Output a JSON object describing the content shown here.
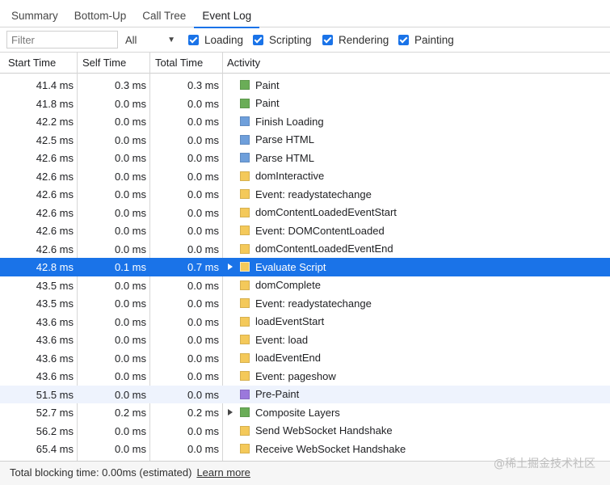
{
  "tabs": [
    {
      "label": "Summary",
      "active": false
    },
    {
      "label": "Bottom-Up",
      "active": false
    },
    {
      "label": "Call Tree",
      "active": false
    },
    {
      "label": "Event Log",
      "active": true
    }
  ],
  "filterbar": {
    "filter_placeholder": "Filter",
    "select_value": "All",
    "checkboxes": [
      {
        "label": "Loading",
        "checked": true
      },
      {
        "label": "Scripting",
        "checked": true
      },
      {
        "label": "Rendering",
        "checked": true
      },
      {
        "label": "Painting",
        "checked": true
      }
    ]
  },
  "columns": [
    "Start Time",
    "Self Time",
    "Total Time",
    "Activity"
  ],
  "colors": {
    "painting": "#6aad57",
    "loading": "#6e9fdb",
    "scripting": "#f4c95a",
    "rendering": "#9b78dc",
    "selection": "#1a73e8"
  },
  "rows": [
    {
      "start": "41.4 ms",
      "self": "0.3 ms",
      "total": "0.3 ms",
      "activity": "Paint",
      "category": "painting",
      "expandable": false
    },
    {
      "start": "41.8 ms",
      "self": "0.0 ms",
      "total": "0.0 ms",
      "activity": "Paint",
      "category": "painting",
      "expandable": false
    },
    {
      "start": "42.2 ms",
      "self": "0.0 ms",
      "total": "0.0 ms",
      "activity": "Finish Loading",
      "category": "loading",
      "expandable": false
    },
    {
      "start": "42.5 ms",
      "self": "0.0 ms",
      "total": "0.0 ms",
      "activity": "Parse HTML",
      "category": "loading",
      "expandable": false
    },
    {
      "start": "42.6 ms",
      "self": "0.0 ms",
      "total": "0.0 ms",
      "activity": "Parse HTML",
      "category": "loading",
      "expandable": false
    },
    {
      "start": "42.6 ms",
      "self": "0.0 ms",
      "total": "0.0 ms",
      "activity": "domInteractive",
      "category": "scripting",
      "expandable": false
    },
    {
      "start": "42.6 ms",
      "self": "0.0 ms",
      "total": "0.0 ms",
      "activity": "Event: readystatechange",
      "category": "scripting",
      "expandable": false
    },
    {
      "start": "42.6 ms",
      "self": "0.0 ms",
      "total": "0.0 ms",
      "activity": "domContentLoadedEventStart",
      "category": "scripting",
      "expandable": false
    },
    {
      "start": "42.6 ms",
      "self": "0.0 ms",
      "total": "0.0 ms",
      "activity": "Event: DOMContentLoaded",
      "category": "scripting",
      "expandable": false
    },
    {
      "start": "42.6 ms",
      "self": "0.0 ms",
      "total": "0.0 ms",
      "activity": "domContentLoadedEventEnd",
      "category": "scripting",
      "expandable": false
    },
    {
      "start": "42.8 ms",
      "self": "0.1 ms",
      "total": "0.7 ms",
      "activity": "Evaluate Script",
      "category": "scripting",
      "expandable": true,
      "selected": true
    },
    {
      "start": "43.5 ms",
      "self": "0.0 ms",
      "total": "0.0 ms",
      "activity": "domComplete",
      "category": "scripting",
      "expandable": false
    },
    {
      "start": "43.5 ms",
      "self": "0.0 ms",
      "total": "0.0 ms",
      "activity": "Event: readystatechange",
      "category": "scripting",
      "expandable": false
    },
    {
      "start": "43.6 ms",
      "self": "0.0 ms",
      "total": "0.0 ms",
      "activity": "loadEventStart",
      "category": "scripting",
      "expandable": false
    },
    {
      "start": "43.6 ms",
      "self": "0.0 ms",
      "total": "0.0 ms",
      "activity": "Event: load",
      "category": "scripting",
      "expandable": false
    },
    {
      "start": "43.6 ms",
      "self": "0.0 ms",
      "total": "0.0 ms",
      "activity": "loadEventEnd",
      "category": "scripting",
      "expandable": false
    },
    {
      "start": "43.6 ms",
      "self": "0.0 ms",
      "total": "0.0 ms",
      "activity": "Event: pageshow",
      "category": "scripting",
      "expandable": false
    },
    {
      "start": "51.5 ms",
      "self": "0.0 ms",
      "total": "0.0 ms",
      "activity": "Pre-Paint",
      "category": "rendering",
      "expandable": false,
      "hover": true
    },
    {
      "start": "52.7 ms",
      "self": "0.2 ms",
      "total": "0.2 ms",
      "activity": "Composite Layers",
      "category": "painting",
      "expandable": true
    },
    {
      "start": "56.2 ms",
      "self": "0.0 ms",
      "total": "0.0 ms",
      "activity": "Send WebSocket Handshake",
      "category": "scripting",
      "expandable": false
    },
    {
      "start": "65.4 ms",
      "self": "0.0 ms",
      "total": "0.0 ms",
      "activity": "Receive WebSocket Handshake",
      "category": "scripting",
      "expandable": false
    }
  ],
  "footer": {
    "text": "Total blocking time: 0.00ms (estimated)",
    "link": "Learn more"
  },
  "watermark": "@稀土掘金技术社区"
}
